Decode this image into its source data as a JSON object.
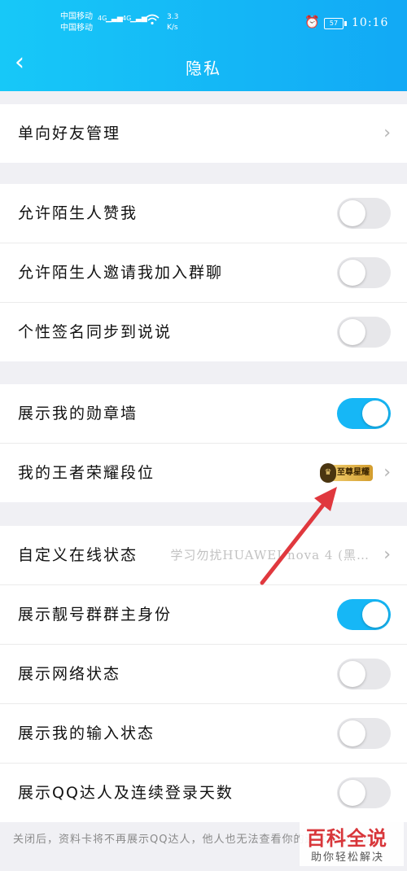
{
  "status_bar": {
    "carrier1": "中国移动",
    "carrier2": "中国移动",
    "network1": "4G",
    "network2": "4G",
    "speed_value": "3.3",
    "speed_unit": "K/s",
    "battery": "57",
    "time": "10:16"
  },
  "header": {
    "back_icon": "‹",
    "title": "隐私"
  },
  "section1": {
    "friend_mgmt": {
      "label": "单向好友管理"
    }
  },
  "section2": {
    "allow_stranger_like": {
      "label": "允许陌生人赞我",
      "on": false
    },
    "allow_stranger_invite": {
      "label": "允许陌生人邀请我加入群聊",
      "on": false
    },
    "sync_signature": {
      "label": "个性签名同步到说说",
      "on": false
    }
  },
  "section3": {
    "show_medal_wall": {
      "label": "展示我的勋章墙",
      "on": true
    },
    "honor_rank": {
      "label": "我的王者荣耀段位",
      "badge": "至尊星耀"
    }
  },
  "section4": {
    "online_status": {
      "label": "自定义在线状态",
      "value": "学习勿扰HUAWEI nova 4 (黑…"
    },
    "show_group_owner": {
      "label": "展示靓号群群主身份",
      "on": true
    },
    "show_network": {
      "label": "展示网络状态",
      "on": false
    },
    "show_typing": {
      "label": "展示我的输入状态",
      "on": false
    },
    "show_qq_expert": {
      "label": "展示QQ达人及连续登录天数",
      "on": false
    }
  },
  "footnote": "关闭后，资料卡将不再展示QQ达人，他人也无法查看你的连续登录天数。",
  "watermark": {
    "title": "百科全说",
    "subtitle": "助你轻松解决"
  },
  "colors": {
    "header": "#12a9f5",
    "toggle_on": "#16b7f6",
    "arrow": "#e0383e"
  }
}
